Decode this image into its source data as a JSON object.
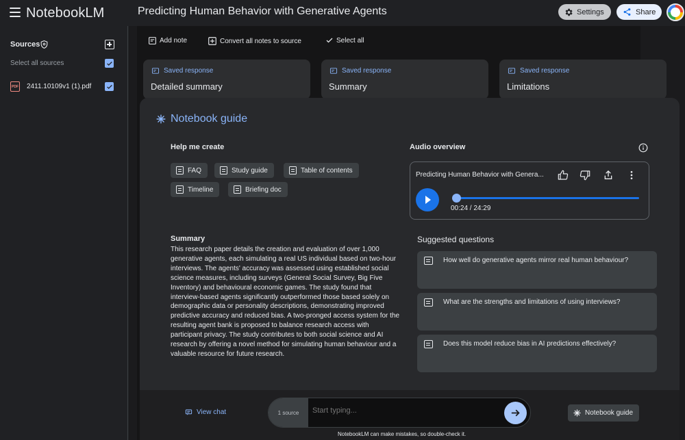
{
  "app": {
    "name": "NotebookLM",
    "notebook_title": "Predicting Human Behavior with Generative Agents"
  },
  "header": {
    "settings_label": "Settings",
    "share_label": "Share"
  },
  "sidebar": {
    "sources_label": "Sources",
    "select_all_label": "Select all sources",
    "select_all_checked": true,
    "sources": [
      {
        "name": "2411.10109v1 (1).pdf",
        "icon": "pdf-icon",
        "badge": "PDF",
        "checked": true
      }
    ]
  },
  "toolbar": {
    "add_note": "Add note",
    "convert_notes": "Convert all notes to source",
    "select_all": "Select all"
  },
  "notes": [
    {
      "label": "Saved response",
      "title": "Detailed summary"
    },
    {
      "label": "Saved response",
      "title": "Summary"
    },
    {
      "label": "Saved response",
      "title": "Limitations"
    }
  ],
  "guide": {
    "title": "Notebook guide",
    "help_me_create": {
      "heading": "Help me create",
      "chips": [
        "FAQ",
        "Study guide",
        "Table of contents",
        "Timeline",
        "Briefing doc"
      ]
    },
    "audio": {
      "heading": "Audio overview",
      "title": "Predicting Human Behavior with Genera...",
      "time": "00:24 / 24:29",
      "progress_fraction": 0.016
    },
    "summary": {
      "heading": "Summary",
      "text": "This research paper details the creation and evaluation of over 1,000 generative agents, each simulating a real US individual based on two-hour interviews. The agents' accuracy was assessed using established social science measures, including surveys (General Social Survey, Big Five Inventory) and behavioural economic games. The study found that interview-based agents significantly outperformed those based solely on demographic data or personality descriptions, demonstrating improved predictive accuracy and reduced bias. A two-pronged access system for the resulting agent bank is proposed to balance research access with participant privacy. The study contributes to both social science and AI research by offering a novel method for simulating human behaviour and a valuable resource for future research."
    },
    "suggested": {
      "heading": "Suggested questions",
      "questions": [
        "How well do generative agents mirror real human behaviour?",
        "What are the strengths and limitations of using interviews?",
        "Does this model reduce bias in AI predictions effectively?"
      ]
    }
  },
  "chat": {
    "view_chat": "View chat",
    "source_count": "1 source",
    "placeholder": "Start typing...",
    "guide_button": "Notebook guide",
    "disclaimer": "NotebookLM can make mistakes, so double-check it."
  },
  "colors": {
    "accent": "#8ab4f8",
    "primary_button": "#1a73e8",
    "pdf": "#f28b82"
  }
}
